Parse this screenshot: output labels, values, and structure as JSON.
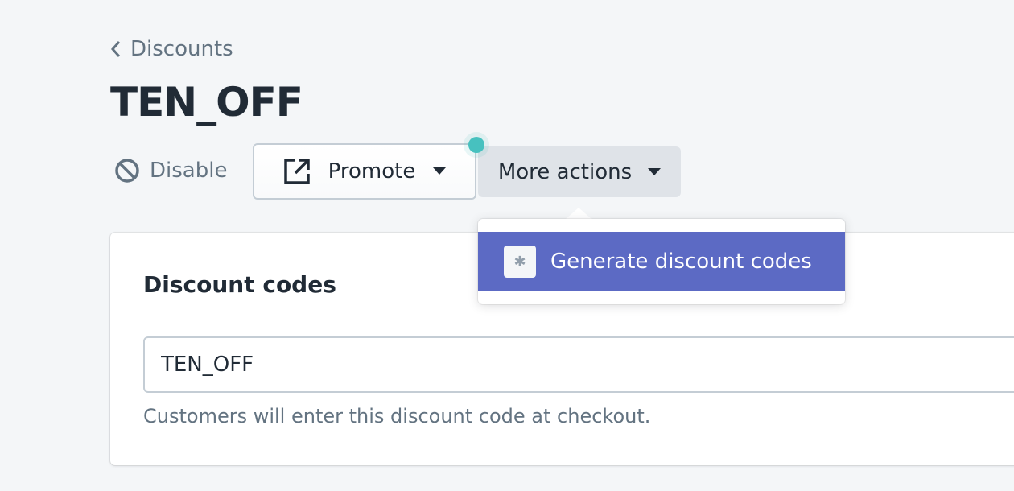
{
  "breadcrumb": {
    "label": "Discounts"
  },
  "page": {
    "title": "TEN_OFF"
  },
  "actions": {
    "disable": "Disable",
    "promote": "Promote",
    "more_actions": "More actions"
  },
  "menu": {
    "items": [
      {
        "label": "Generate discount codes",
        "icon": "puzzle-icon"
      }
    ]
  },
  "card": {
    "title": "Discount codes",
    "code_value": "TEN_OFF",
    "help_text": "Customers will enter this discount code at checkout."
  },
  "colors": {
    "accent": "#5c6ac4",
    "badge": "#47c1bf"
  }
}
